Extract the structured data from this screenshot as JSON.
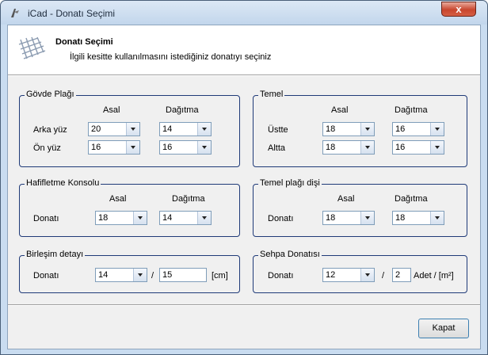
{
  "window": {
    "title": "iCad - Donatı Seçimi",
    "close_label": "x"
  },
  "header": {
    "title": "Donatı Seçimi",
    "subtitle": "İlgili kesitte kullanılmasını istediğiniz donatıyı  seçiniz"
  },
  "govde": {
    "legend": "Gövde Plağı",
    "col_asal": "Asal",
    "col_dagitma": "Dağıtma",
    "row1_label": "Arka yüz",
    "row1_asal": "20",
    "row1_dagitma": "14",
    "row2_label": "Ön yüz",
    "row2_asal": "16",
    "row2_dagitma": "16"
  },
  "temel": {
    "legend": "Temel",
    "col_asal": "Asal",
    "col_dagitma": "Dağıtma",
    "row1_label": "Üstte",
    "row1_asal": "18",
    "row1_dagitma": "16",
    "row2_label": "Altta",
    "row2_asal": "18",
    "row2_dagitma": "16"
  },
  "hafifletme": {
    "legend": "Hafifletme Konsolu",
    "col_asal": "Asal",
    "col_dagitma": "Dağıtma",
    "row_label": "Donatı",
    "asal": "18",
    "dagitma": "14"
  },
  "temel_disi": {
    "legend": "Temel plağı dişi",
    "col_asal": "Asal",
    "col_dagitma": "Dağıtma",
    "row_label": "Donatı",
    "asal": "18",
    "dagitma": "18"
  },
  "birlesim": {
    "legend": "Birleşim detayı",
    "row_label": "Donatı",
    "combo_value": "14",
    "slash": "/",
    "spacing": "15",
    "unit": "[cm]"
  },
  "sehpa": {
    "legend": "Sehpa Donatısı",
    "row_label": "Donatı",
    "combo_value": "12",
    "slash": "/",
    "count": "2",
    "unit": "Adet /  [m²]"
  },
  "buttons": {
    "ok": "Kapat"
  }
}
